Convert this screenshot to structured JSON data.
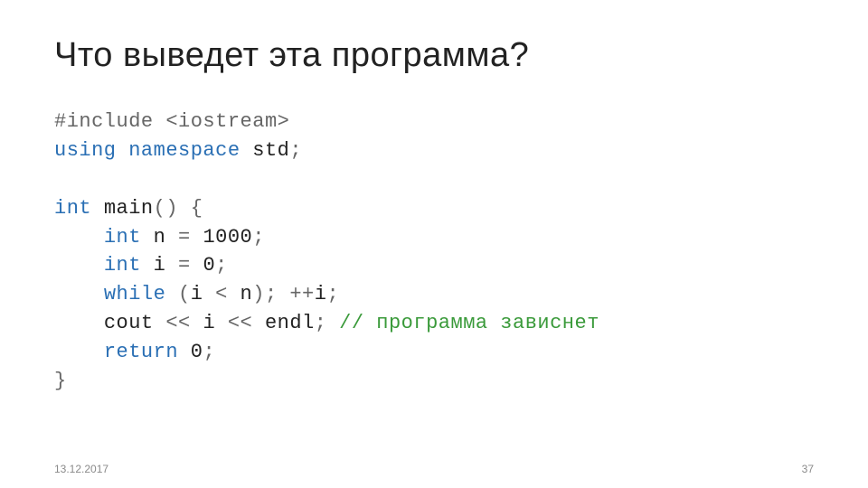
{
  "slide": {
    "title": "Что выведет эта программа?",
    "date": "13.12.2017",
    "pageNumber": "37"
  },
  "code": {
    "line1_a": "#include",
    "line1_b": "<iostream>",
    "line2_a": "using",
    "line2_b": "namespace",
    "line2_c": "std",
    "line2_d": ";",
    "blank": "",
    "line4_a": "int",
    "line4_b": "main",
    "line4_c": "() {",
    "line5_indent": "    ",
    "line5_a": "int",
    "line5_b": "n",
    "line5_c": "=",
    "line5_d": "1000",
    "line5_e": ";",
    "line6_a": "int",
    "line6_b": "i",
    "line6_c": "=",
    "line6_d": "0",
    "line6_e": ";",
    "line7_a": "while",
    "line7_b": "(",
    "line7_c": "i",
    "line7_d": "<",
    "line7_e": "n",
    "line7_f": "); ++",
    "line7_g": "i",
    "line7_h": ";",
    "line8_a": "cout",
    "line8_b": "<<",
    "line8_c": "i",
    "line8_d": "<<",
    "line8_e": "endl",
    "line8_f": ";",
    "line8_cm": "// программа зависнет",
    "line9_a": "return",
    "line9_b": "0",
    "line9_c": ";",
    "line10": "}"
  }
}
